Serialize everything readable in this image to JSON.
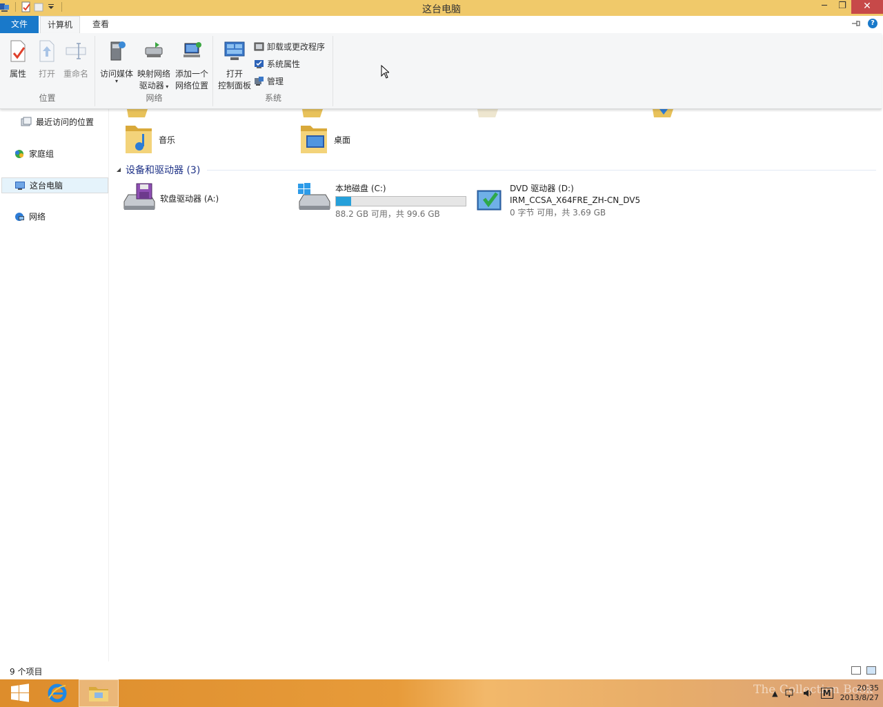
{
  "window": {
    "title": "这台电脑",
    "controls": {
      "minimize": "─",
      "maximize": "❐",
      "close": "✕"
    }
  },
  "ribbon": {
    "tabs": [
      {
        "label": "文件"
      },
      {
        "label": "计算机"
      },
      {
        "label": "查看"
      }
    ],
    "groups": [
      {
        "label": "位置",
        "buttons": [
          {
            "label": "属性",
            "icon": "properties-icon"
          },
          {
            "label": "打开",
            "icon": "open-icon"
          },
          {
            "label": "重命名",
            "icon": "rename-icon"
          }
        ]
      },
      {
        "label": "网络",
        "buttons": [
          {
            "label": "访问媒体",
            "icon": "media-icon"
          },
          {
            "label_line1": "映射网络",
            "label_line2": "驱动器",
            "icon": "map-drive-icon"
          },
          {
            "label_line1": "添加一个",
            "label_line2": "网络位置",
            "icon": "add-network-location-icon"
          }
        ]
      },
      {
        "label": "系统",
        "buttons": [
          {
            "label_line1": "打开",
            "label_line2": "控制面板",
            "icon": "control-panel-icon"
          },
          {
            "label": "卸载或更改程序",
            "icon": "uninstall-icon"
          },
          {
            "label": "系统属性",
            "icon": "system-properties-icon"
          },
          {
            "label": "管理",
            "icon": "manage-icon"
          }
        ]
      }
    ]
  },
  "nav": {
    "items": [
      {
        "label": "最近访问的位置",
        "icon": "recent-places-icon"
      },
      {
        "label": "家庭组",
        "icon": "homegroup-icon"
      },
      {
        "label": "这台电脑",
        "icon": "this-pc-icon"
      },
      {
        "label": "网络",
        "icon": "network-icon"
      }
    ]
  },
  "content": {
    "folders": [
      {
        "label": "音乐",
        "icon": "music-folder-icon"
      },
      {
        "label": "桌面",
        "icon": "desktop-folder-icon"
      }
    ],
    "devices_section": {
      "title": "设备和驱动器 (3)"
    },
    "drives": [
      {
        "name": "软盘驱动器 (A:)",
        "icon": "floppy-drive-icon"
      },
      {
        "name": "本地磁盘 (C:)",
        "icon": "local-disk-icon",
        "used_fraction": 0.115,
        "space": "88.2 GB 可用，共 99.6 GB"
      },
      {
        "name": "DVD 驱动器 (D:)",
        "label": "IRM_CCSA_X64FRE_ZH-CN_DV5",
        "icon": "dvd-drive-icon",
        "space": "0 字节 可用，共 3.69 GB"
      }
    ]
  },
  "statusbar": {
    "count": "9 个项目"
  },
  "taskbar": {
    "clock_time": "20:35",
    "clock_date": "2013/8/27",
    "ime": "M",
    "watermark": "The Collection Book"
  },
  "colors": {
    "titlebar": "#f0c96a",
    "file_tab": "#1979ca",
    "accent_bar": "#26a0da",
    "section_header": "#1e3287"
  }
}
